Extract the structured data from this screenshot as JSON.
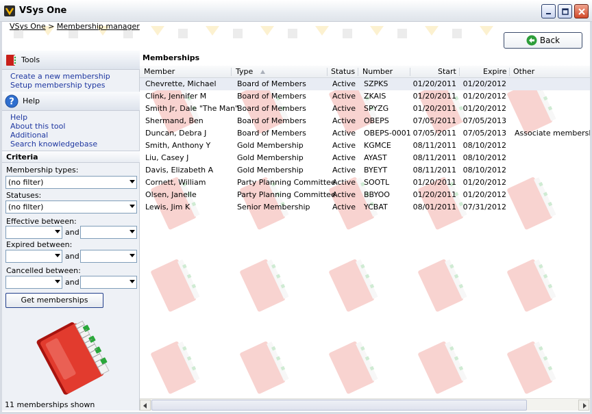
{
  "window": {
    "title": "VSys One"
  },
  "breadcrumb": {
    "home": "VSys One",
    "separator": ">",
    "current": "Membership manager"
  },
  "back_button": {
    "label": "Back"
  },
  "tools": {
    "title": "Tools",
    "links": [
      "Create a new membership",
      "Setup membership types"
    ]
  },
  "help": {
    "title": "Help",
    "links": [
      "Help",
      "About this tool",
      "Additional",
      "Search knowledgebase"
    ]
  },
  "criteria": {
    "title": "Criteria",
    "membership_types_label": "Membership types:",
    "membership_types_value": "(no filter)",
    "statuses_label": "Statuses:",
    "statuses_value": "(no filter)",
    "effective_label": "Effective between:",
    "expired_label": "Expired between:",
    "cancelled_label": "Cancelled between:",
    "and_label": "and",
    "get_button": "Get memberships"
  },
  "status_bar": {
    "text": "11 memberships shown"
  },
  "grid": {
    "title": "Memberships",
    "columns": [
      "Member",
      "Type",
      "Status",
      "Number",
      "Start",
      "Expire",
      "Other"
    ],
    "rows": [
      [
        "Chevrette, Michael",
        "Board of Members",
        "Active",
        "SZPKS",
        "01/20/2011",
        "01/20/2012",
        ""
      ],
      [
        "Clink, Jennifer M",
        "Board of Members",
        "Active",
        "ZKAIS",
        "01/20/2011",
        "01/20/2012",
        ""
      ],
      [
        "Smith Jr, Dale \"The Man\"",
        "Board of Members",
        "Active",
        "SPYZG",
        "01/20/2011",
        "01/20/2012",
        ""
      ],
      [
        "Shermand, Ben",
        "Board of Members",
        "Active",
        "OBEPS",
        "07/05/2011",
        "07/05/2013",
        ""
      ],
      [
        "Duncan, Debra J",
        "Board of Members",
        "Active",
        "OBEPS-0001",
        "07/05/2011",
        "07/05/2013",
        "Associate membership"
      ],
      [
        "Smith, Anthony Y",
        "Gold Membership",
        "Active",
        "KGMCE",
        "08/11/2011",
        "08/10/2012",
        ""
      ],
      [
        "Liu, Casey J",
        "Gold Membership",
        "Active",
        "AYAST",
        "08/11/2011",
        "08/10/2012",
        ""
      ],
      [
        "Davis, Elizabeth A",
        "Gold Membership",
        "Active",
        "BYEYT",
        "08/11/2011",
        "08/10/2012",
        ""
      ],
      [
        "Cornett, William",
        "Party Planning Committee",
        "Active",
        "SOOTL",
        "01/20/2011",
        "01/20/2012",
        ""
      ],
      [
        "Olsen, Janelle",
        "Party Planning Committee",
        "Active",
        "BBYOO",
        "01/20/2011",
        "01/20/2012",
        ""
      ],
      [
        "Lewis, Jim K",
        "Senior Membership",
        "Active",
        "YCBAT",
        "08/01/2011",
        "07/31/2012",
        ""
      ]
    ]
  },
  "colors": {
    "link": "#1d36a0",
    "selected_row": "#e8ecf4",
    "book_red": "#d9241c",
    "book_green": "#2aa83a"
  }
}
